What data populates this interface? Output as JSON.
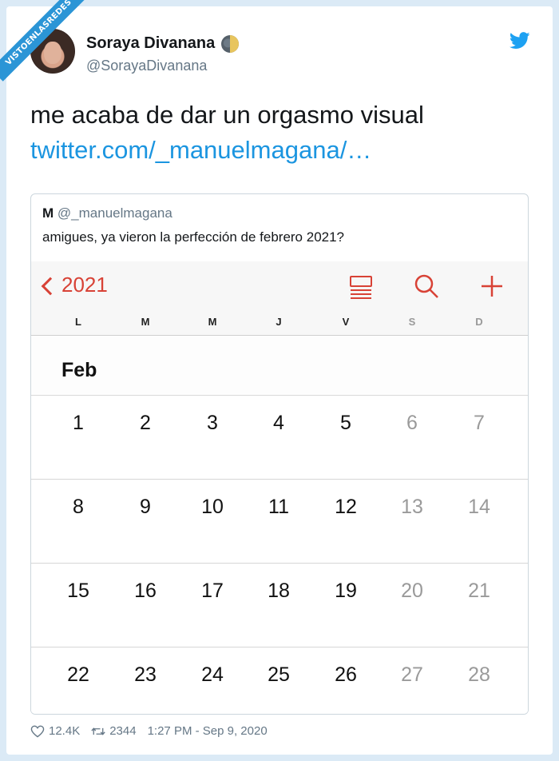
{
  "watermark": "VISTOENLASREDES",
  "tweet": {
    "author_name": "Soraya Divanana",
    "author_handle": "@SorayaDivanana",
    "text_line1": "me acaba de dar un orgasmo visual",
    "link": "twitter.com/_manuelmagana/…",
    "likes": "12.4K",
    "retweets": "2344",
    "timestamp": "1:27 PM - Sep 9, 2020",
    "brand_color": "#1da1f2"
  },
  "quoted": {
    "author_initial": "M",
    "author_handle": "@_manuelmagana",
    "text": "amigues, ya vieron la perfección de febrero 2021?"
  },
  "calendar": {
    "back_label": "2021",
    "accent_color": "#d84236",
    "weekdays": [
      "L",
      "M",
      "M",
      "J",
      "V",
      "S",
      "D"
    ],
    "month": "Feb",
    "weeks": [
      [
        "1",
        "2",
        "3",
        "4",
        "5",
        "6",
        "7"
      ],
      [
        "8",
        "9",
        "10",
        "11",
        "12",
        "13",
        "14"
      ],
      [
        "15",
        "16",
        "17",
        "18",
        "19",
        "20",
        "21"
      ],
      [
        "22",
        "23",
        "24",
        "25",
        "26",
        "27",
        "28"
      ]
    ],
    "icons": [
      "list-view-icon",
      "search-icon",
      "add-icon"
    ]
  }
}
